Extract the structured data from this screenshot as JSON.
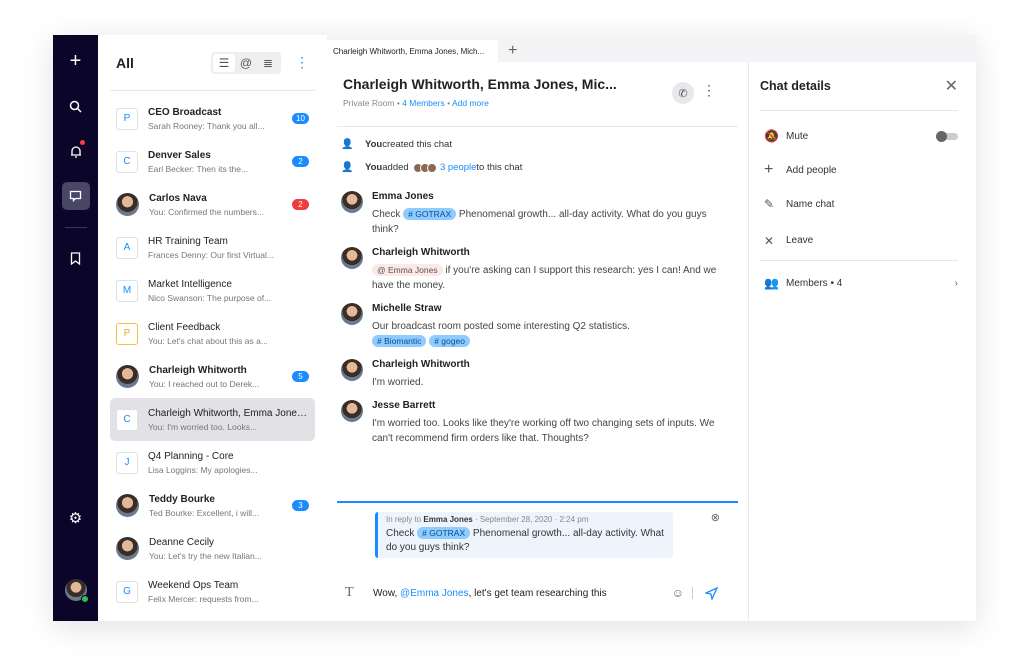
{
  "rail": {
    "items": [
      "plus-icon",
      "search-icon",
      "bell-icon",
      "chat-icon",
      "bookmark-icon",
      "gear-icon"
    ]
  },
  "list": {
    "title": "All",
    "chats": [
      {
        "avatar": "P",
        "name": "CEO Broadcast",
        "preview": "Sarah Rooney: Thank you all...",
        "badge": "10",
        "bold": true
      },
      {
        "avatar": "C",
        "name": "Denver Sales",
        "preview": "Earl Becker: Then its the...",
        "badge": "2",
        "bold": true
      },
      {
        "avatar": "photo",
        "name": "Carlos Nava",
        "preview": "You: Confirmed the numbers...",
        "badge": "2",
        "badge_color": "red",
        "bold": true
      },
      {
        "avatar": "A",
        "name": "HR Training Team",
        "preview": "Frances Denny: Our first Virtual..."
      },
      {
        "avatar": "M",
        "name": "Market Intelligence",
        "preview": "Nico Swanson: The purpose of..."
      },
      {
        "avatar": "P",
        "name": "Client Feedback",
        "preview": "You: Let's chat about this as a...",
        "avatar_color": "yellow"
      },
      {
        "avatar": "photo",
        "name": "Charleigh Whitworth",
        "preview": "You: I reached out to Derek...",
        "badge": "5",
        "bold": true
      },
      {
        "avatar": "C",
        "name": "Charleigh Whitworth, Emma Jones...",
        "preview": "You: I'm worried too. Looks...",
        "selected": true
      },
      {
        "avatar": "J",
        "name": "Q4 Planning - Core",
        "preview": "Lisa Loggins: My apologies..."
      },
      {
        "avatar": "photo",
        "name": "Teddy Bourke",
        "preview": "Ted Bourke: Excellent, i will...",
        "badge": "3",
        "bold": true
      },
      {
        "avatar": "photo",
        "name": "Deanne Cecily",
        "preview": "You: Let's try the new Italian..."
      },
      {
        "avatar": "G",
        "name": "Weekend Ops Team",
        "preview": "Felix Mercer: requests from..."
      }
    ]
  },
  "tab": {
    "label": "Charleigh Whitworth, Emma Jones, Mich..."
  },
  "header": {
    "title": "Charleigh Whitworth, Emma Jones, Mic...",
    "type": "Private Room",
    "members": "4 Members",
    "add_more": "Add more"
  },
  "system": {
    "you": "You",
    "created": " created this chat",
    "added": " added",
    "people": "3 people",
    "to_chat": " to this chat"
  },
  "messages": [
    {
      "name": "Emma Jones",
      "pre": "Check ",
      "tag": "GOTRAX",
      "post": " Phenomenal growth... all-day activity. What do you guys think?"
    },
    {
      "name": "Charleigh Whitworth",
      "mention": "Emma Jones",
      "post": " if you're asking can I support this research: yes I can! And we have the money."
    },
    {
      "name": "Michelle Straw",
      "pre": "Our broadcast room posted some interesting Q2 statistics.",
      "tags": [
        "Biomantic",
        "gogeo"
      ]
    },
    {
      "name": "Charleigh Whitworth",
      "pre": "I'm worried."
    },
    {
      "name": "Jesse Barrett",
      "pre": "I'm worried too. Looks like they're working off two changing sets of inputs. We can't recommend firm orders like that. Thoughts?"
    }
  ],
  "reply": {
    "in_reply_to": "In reply to",
    "author": "Emma Jones",
    "date": "September 28, 2020",
    "time": "2:24 pm",
    "pre": "Check ",
    "tag": "GOTRAX",
    "post": " Phenomenal growth... all-day activity. What do you guys think?"
  },
  "composer": {
    "pre": "Wow, ",
    "mention": "@Emma Jones",
    "post": ", let's get team researching this"
  },
  "details": {
    "title": "Chat details",
    "mute": "Mute",
    "mute_on": false,
    "add_people": "Add people",
    "name_chat": "Name chat",
    "leave": "Leave",
    "members": "Members • 4"
  },
  "colors": {
    "accent": "#1a8cff",
    "rail": "#0b0629",
    "badge_red": "#ef3b3b"
  }
}
